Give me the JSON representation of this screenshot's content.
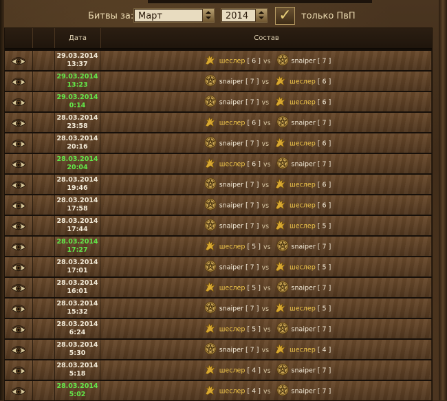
{
  "filter": {
    "label": "Битвы за:",
    "month": "Март",
    "year": "2014",
    "pvp_checked": true,
    "pvp_label": "только ПвП"
  },
  "table": {
    "headers": {
      "date": "Дата",
      "composition": "Состав"
    },
    "vs": "vs",
    "rows": [
      {
        "date": "29.03.2014",
        "time": "13:37",
        "green": false,
        "left": {
          "name": "шеслер",
          "lvl": "[ 6 ]",
          "icon": "gryphon-icon",
          "hl": true
        },
        "right": {
          "name": "snaiper",
          "lvl": "[ 7 ]",
          "icon": "pentagram-icon",
          "hl": false
        }
      },
      {
        "date": "29.03.2014",
        "time": "13:23",
        "green": true,
        "left": {
          "name": "snaiper",
          "lvl": "[ 7 ]",
          "icon": "pentagram-icon",
          "hl": false
        },
        "right": {
          "name": "шеслер",
          "lvl": "[ 6 ]",
          "icon": "gryphon-icon",
          "hl": true
        }
      },
      {
        "date": "29.03.2014",
        "time": "0:14",
        "green": true,
        "left": {
          "name": "snaiper",
          "lvl": "[ 7 ]",
          "icon": "pentagram-icon",
          "hl": false
        },
        "right": {
          "name": "шеслер",
          "lvl": "[ 6 ]",
          "icon": "gryphon-icon",
          "hl": true
        }
      },
      {
        "date": "28.03.2014",
        "time": "23:58",
        "green": false,
        "left": {
          "name": "шеслер",
          "lvl": "[ 6 ]",
          "icon": "gryphon-icon",
          "hl": true
        },
        "right": {
          "name": "snaiper",
          "lvl": "[ 7 ]",
          "icon": "pentagram-icon",
          "hl": false
        }
      },
      {
        "date": "28.03.2014",
        "time": "20:16",
        "green": false,
        "left": {
          "name": "snaiper",
          "lvl": "[ 7 ]",
          "icon": "pentagram-icon",
          "hl": false
        },
        "right": {
          "name": "шеслер",
          "lvl": "[ 6 ]",
          "icon": "gryphon-icon",
          "hl": true
        }
      },
      {
        "date": "28.03.2014",
        "time": "20:04",
        "green": true,
        "left": {
          "name": "шеслер",
          "lvl": "[ 6 ]",
          "icon": "gryphon-icon",
          "hl": true
        },
        "right": {
          "name": "snaiper",
          "lvl": "[ 7 ]",
          "icon": "pentagram-icon",
          "hl": false
        }
      },
      {
        "date": "28.03.2014",
        "time": "19:46",
        "green": false,
        "left": {
          "name": "snaiper",
          "lvl": "[ 7 ]",
          "icon": "pentagram-icon",
          "hl": false
        },
        "right": {
          "name": "шеслер",
          "lvl": "[ 6 ]",
          "icon": "gryphon-icon",
          "hl": true
        }
      },
      {
        "date": "28.03.2014",
        "time": "17:58",
        "green": false,
        "left": {
          "name": "snaiper",
          "lvl": "[ 7 ]",
          "icon": "pentagram-icon",
          "hl": false
        },
        "right": {
          "name": "шеслер",
          "lvl": "[ 6 ]",
          "icon": "gryphon-icon",
          "hl": true
        }
      },
      {
        "date": "28.03.2014",
        "time": "17:44",
        "green": false,
        "left": {
          "name": "snaiper",
          "lvl": "[ 7 ]",
          "icon": "pentagram-icon",
          "hl": false
        },
        "right": {
          "name": "шеслер",
          "lvl": "[ 5 ]",
          "icon": "gryphon-icon",
          "hl": true
        }
      },
      {
        "date": "28.03.2014",
        "time": "17:27",
        "green": true,
        "left": {
          "name": "шеслер",
          "lvl": "[ 5 ]",
          "icon": "gryphon-icon",
          "hl": true
        },
        "right": {
          "name": "snaiper",
          "lvl": "[ 7 ]",
          "icon": "pentagram-icon",
          "hl": false
        }
      },
      {
        "date": "28.03.2014",
        "time": "17:01",
        "green": false,
        "left": {
          "name": "snaiper",
          "lvl": "[ 7 ]",
          "icon": "pentagram-icon",
          "hl": false
        },
        "right": {
          "name": "шеслер",
          "lvl": "[ 5 ]",
          "icon": "gryphon-icon",
          "hl": true
        }
      },
      {
        "date": "28.03.2014",
        "time": "16:01",
        "green": false,
        "left": {
          "name": "шеслер",
          "lvl": "[ 5 ]",
          "icon": "gryphon-icon",
          "hl": true
        },
        "right": {
          "name": "snaiper",
          "lvl": "[ 7 ]",
          "icon": "pentagram-icon",
          "hl": false
        }
      },
      {
        "date": "28.03.2014",
        "time": "15:32",
        "green": false,
        "left": {
          "name": "snaiper",
          "lvl": "[ 7 ]",
          "icon": "pentagram-icon",
          "hl": false
        },
        "right": {
          "name": "шеслер",
          "lvl": "[ 5 ]",
          "icon": "gryphon-icon",
          "hl": true
        }
      },
      {
        "date": "28.03.2014",
        "time": "6:24",
        "green": false,
        "left": {
          "name": "шеслер",
          "lvl": "[ 5 ]",
          "icon": "gryphon-icon",
          "hl": true
        },
        "right": {
          "name": "snaiper",
          "lvl": "[ 7 ]",
          "icon": "pentagram-icon",
          "hl": false
        }
      },
      {
        "date": "28.03.2014",
        "time": "5:30",
        "green": false,
        "left": {
          "name": "snaiper",
          "lvl": "[ 7 ]",
          "icon": "pentagram-icon",
          "hl": false
        },
        "right": {
          "name": "шеслер",
          "lvl": "[ 4 ]",
          "icon": "gryphon-icon",
          "hl": true
        }
      },
      {
        "date": "28.03.2014",
        "time": "5:18",
        "green": false,
        "left": {
          "name": "шеслер",
          "lvl": "[ 4 ]",
          "icon": "gryphon-icon",
          "hl": true
        },
        "right": {
          "name": "snaiper",
          "lvl": "[ 7 ]",
          "icon": "pentagram-icon",
          "hl": false
        }
      },
      {
        "date": "28.03.2014",
        "time": "5:02",
        "green": true,
        "left": {
          "name": "шеслер",
          "lvl": "[ 4 ]",
          "icon": "gryphon-icon",
          "hl": true
        },
        "right": {
          "name": "snaiper",
          "lvl": "[ 7 ]",
          "icon": "pentagram-icon",
          "hl": false
        }
      }
    ]
  },
  "colors": {
    "highlight_name": "#f0c64a",
    "green_date": "#63e84a",
    "normal_text": "#f2ead8"
  }
}
